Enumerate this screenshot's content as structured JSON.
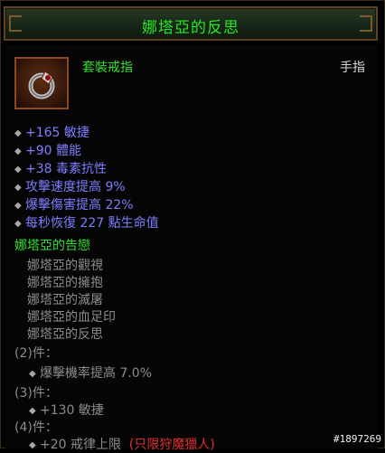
{
  "item": {
    "name": "娜塔亞的反思",
    "type": "套裝戒指",
    "slot": "手指"
  },
  "stats": [
    "+165 敏捷",
    "+90 體能",
    "+38 毒素抗性",
    "攻擊速度提高 9%",
    "爆擊傷害提高 22%",
    "每秒恢復 227 點生命值"
  ],
  "set": {
    "name": "娜塔亞的告戀",
    "items": [
      "娜塔亞的觀視",
      "娜塔亞的擁抱",
      "娜塔亞的滅屠",
      "娜塔亞的血足印",
      "娜塔亞的反思"
    ],
    "bonuses": [
      {
        "head": "(2)件：",
        "line": "爆擊機率提高 7.0%"
      },
      {
        "head": "(3)件：",
        "line": "+130 敏捷"
      },
      {
        "head": "(4)件：",
        "line": "+20 戒律上限",
        "restriction": "(只限狩魔獵人)"
      }
    ]
  },
  "watermark": "#1897269",
  "colors": {
    "set_green": "#30e030",
    "magic_blue": "#7d7dff",
    "inactive_gray": "#8c8c8c",
    "restriction_red": "#e23030"
  }
}
